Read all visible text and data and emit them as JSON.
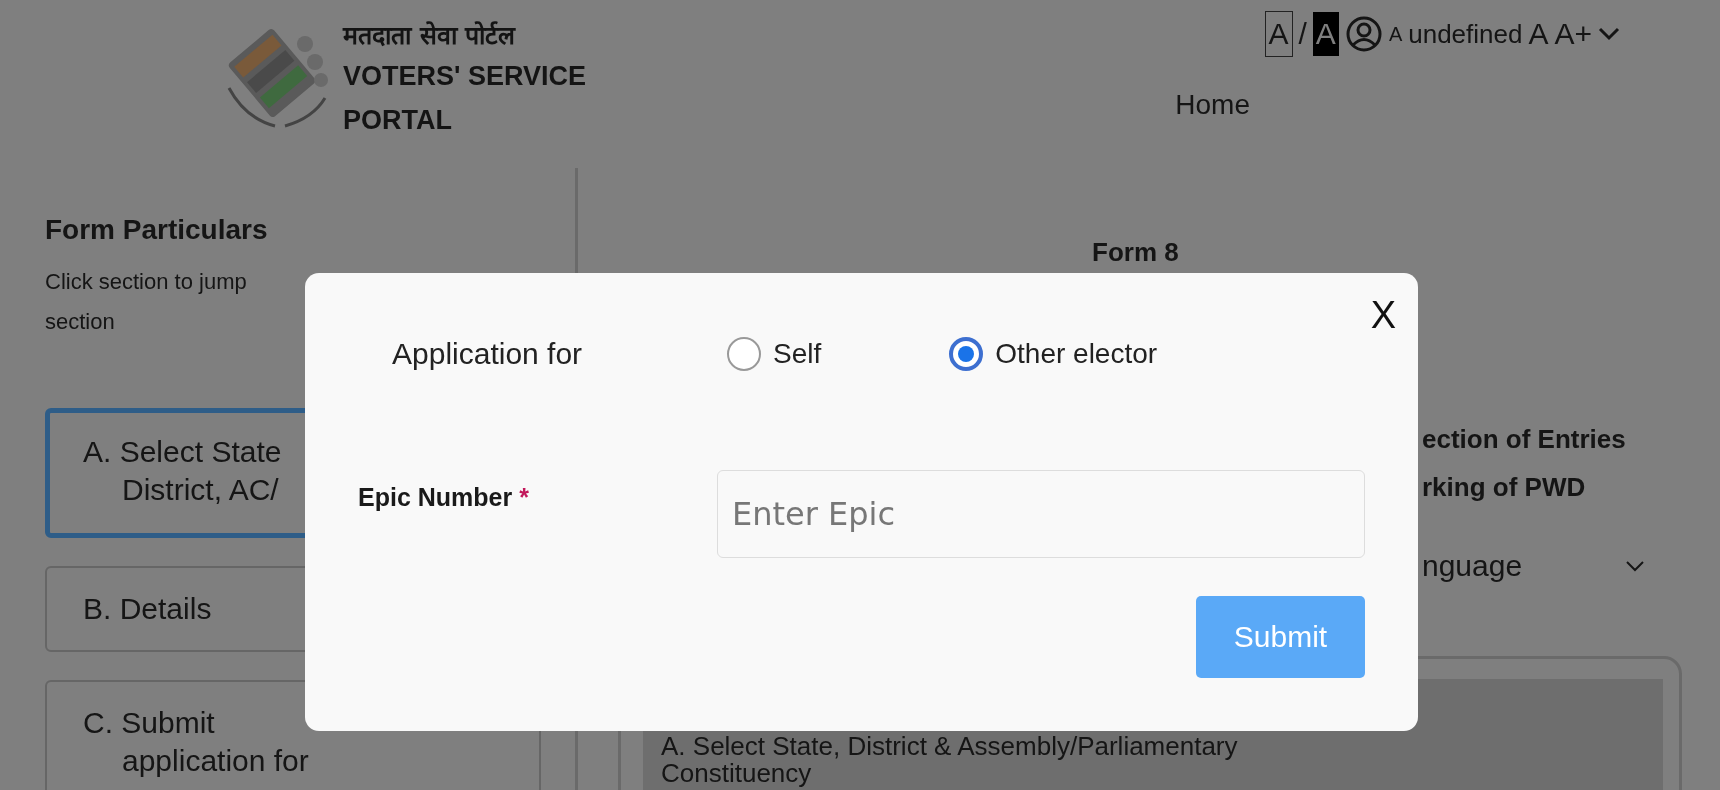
{
  "header": {
    "portal_name_hindi": "मतदाता सेवा पोर्टल",
    "portal_name_lines": [
      "VOTERS' SERVICE",
      "PORTAL"
    ],
    "toolbar": [
      {
        "kind": "boxed",
        "label": "A"
      },
      {
        "kind": "separator",
        "label": "/"
      },
      {
        "kind": "inverted",
        "label": "A"
      },
      {
        "kind": "user"
      },
      {
        "kind": "small",
        "label": "A"
      },
      {
        "kind": "username",
        "label": "undefined"
      },
      {
        "kind": "normal",
        "label": "A"
      },
      {
        "kind": "normal",
        "label": "A+"
      },
      {
        "kind": "chevron"
      }
    ],
    "nav": [
      {
        "label": "Home"
      }
    ]
  },
  "sidebar": {
    "title": "Form Particulars",
    "hint_lines": [
      "Click section to jump",
      "section"
    ],
    "sections": [
      {
        "lines": [
          "A. Select State",
          "District, AC/"
        ],
        "selected": true
      },
      {
        "lines": [
          "B. Details"
        ],
        "selected": false
      },
      {
        "lines": [
          "C. Submit",
          "application for"
        ],
        "selected": false
      }
    ]
  },
  "main": {
    "form_title": "Form 8",
    "partial_lines": [
      "ection of Entries",
      "rking of PWD"
    ],
    "language_select": {
      "value": "nguage"
    },
    "section_panel": {
      "lines": [
        "A. Select State, District & Assembly/Parliamentary",
        "Constituency"
      ]
    }
  },
  "modal": {
    "close": "X",
    "application_for_label": "Application for",
    "options": [
      {
        "label": "Self",
        "selected": false
      },
      {
        "label": "Other elector",
        "selected": true
      }
    ],
    "epic_label": "Epic Number",
    "required_mark": "*",
    "epic_placeholder": "Enter Epic",
    "submit": "Submit"
  }
}
